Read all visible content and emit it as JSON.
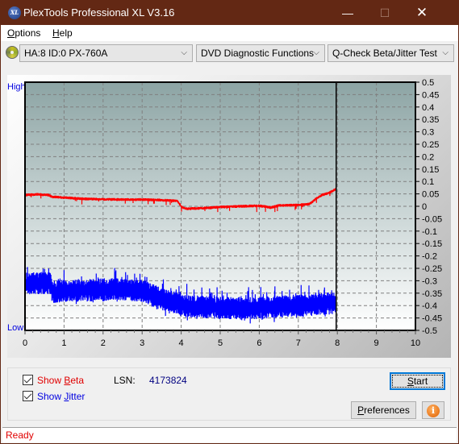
{
  "window": {
    "title": "PlexTools Professional XL V3.16",
    "app_icon_text": "XL",
    "minimize_glyph": "—",
    "maximize_glyph": "☐",
    "close_glyph": "✕"
  },
  "menu": {
    "items": [
      {
        "label": "Options",
        "accel": "O",
        "rest": "ptions"
      },
      {
        "label": "Help",
        "accel": "H",
        "rest": "elp"
      }
    ]
  },
  "toolbar": {
    "drive_select": "HA:8 ID:0  PX-760A",
    "function_select": "DVD Diagnostic Functions",
    "test_select": "Q-Check Beta/Jitter Test",
    "dropdown_glyph": "⌵"
  },
  "chart_labels": {
    "high": "High",
    "low": "Low"
  },
  "chart_data": {
    "type": "line",
    "title": "",
    "xlabel": "",
    "ylabel": "",
    "xlim": [
      0,
      10
    ],
    "ylim": [
      -0.5,
      0.5
    ],
    "x_ticks": [
      "0",
      "1",
      "2",
      "3",
      "4",
      "5",
      "6",
      "7",
      "8",
      "9",
      "10"
    ],
    "y_ticks": [
      "0.5",
      "0.45",
      "0.4",
      "0.35",
      "0.3",
      "0.25",
      "0.2",
      "0.15",
      "0.1",
      "0.05",
      "0",
      "-0.05",
      "-0.1",
      "-0.15",
      "-0.2",
      "-0.25",
      "-0.3",
      "-0.35",
      "-0.4",
      "-0.45",
      "-0.5"
    ],
    "grid": true,
    "cursor_x": 7.97,
    "series": [
      {
        "name": "Beta",
        "color": "#ff0000",
        "x": [
          0,
          0.3,
          0.6,
          0.7,
          1.0,
          1.5,
          2.0,
          2.5,
          3.0,
          3.5,
          3.9,
          4.0,
          4.1,
          4.5,
          5.0,
          5.5,
          6.0,
          6.3,
          6.5,
          7.0,
          7.3,
          7.45,
          7.6,
          7.8,
          7.97
        ],
        "values": [
          0.045,
          0.048,
          0.045,
          0.038,
          0.035,
          0.03,
          0.028,
          0.027,
          0.027,
          0.025,
          0.022,
          0.0,
          -0.01,
          -0.008,
          -0.003,
          0.0,
          0.002,
          -0.005,
          0.003,
          0.005,
          0.01,
          0.03,
          0.045,
          0.055,
          0.07
        ],
        "spread": 0.006
      },
      {
        "name": "Jitter",
        "color": "#0000ff",
        "x": [
          0,
          0.3,
          0.65,
          0.7,
          1.0,
          1.5,
          2.0,
          2.5,
          3.0,
          3.3,
          3.6,
          3.9,
          4.0,
          4.5,
          5.0,
          5.5,
          6.0,
          6.5,
          7.0,
          7.5,
          7.97
        ],
        "values": [
          -0.31,
          -0.31,
          -0.31,
          -0.345,
          -0.34,
          -0.34,
          -0.335,
          -0.335,
          -0.34,
          -0.36,
          -0.38,
          -0.39,
          -0.4,
          -0.405,
          -0.41,
          -0.41,
          -0.41,
          -0.405,
          -0.4,
          -0.395,
          -0.39
        ],
        "spread": 0.03
      }
    ]
  },
  "controls": {
    "show_beta_label": "Show ",
    "show_beta_accel": "B",
    "show_beta_rest": "eta",
    "show_beta_checked": true,
    "show_jitter_label": "Show ",
    "show_jitter_accel": "J",
    "show_jitter_rest": "itter",
    "show_jitter_checked": true,
    "lsn_label": "LSN:",
    "lsn_value": "4173824",
    "start_accel": "S",
    "start_rest": "tart",
    "preferences_accel": "P",
    "preferences_rest": "references",
    "info_glyph": "i"
  },
  "status": {
    "text": "Ready"
  },
  "colors": {
    "titlebar": "#632814",
    "beta": "#ff0000",
    "jitter": "#0000ff",
    "status_text": "#e00000",
    "lsn_value": "#000080",
    "axis_text": "#0000e0"
  }
}
